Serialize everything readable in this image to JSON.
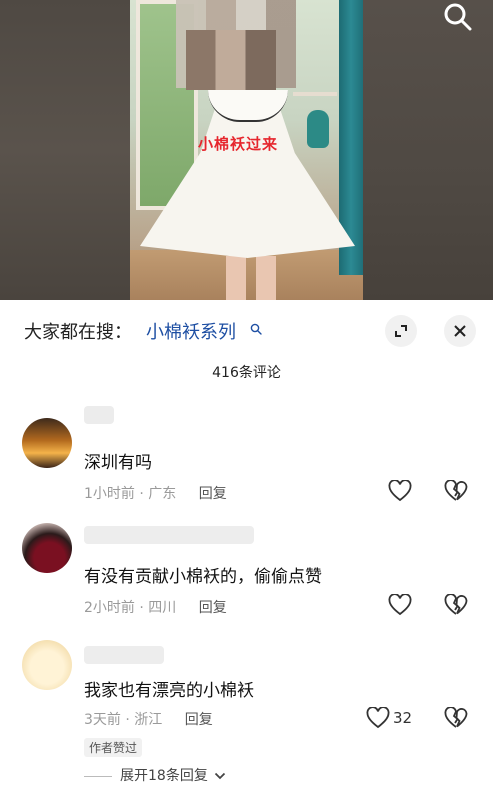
{
  "video": {
    "overlay_text": "小棉袄过来"
  },
  "sheet": {
    "search_prefix": "大家都在搜：",
    "search_term": "小棉袄系列",
    "comment_count": "416条评论"
  },
  "comments": [
    {
      "text": "深圳有吗",
      "time": "1小时前",
      "location": "广东",
      "reply_label": "回复"
    },
    {
      "text": "有没有贡献小棉袄的，偷偷点赞",
      "time": "2小时前",
      "location": "四川",
      "reply_label": "回复"
    },
    {
      "text": "我家也有漂亮的小棉袄",
      "time": "3天前",
      "location": "浙江",
      "reply_label": "回复",
      "like_count": "32",
      "badge": "作者赞过",
      "expand_label": "展开18条回复"
    }
  ],
  "icons": {
    "search": "search-icon",
    "expand": "expand-icon",
    "close": "close-icon",
    "like": "heart-icon",
    "dislike": "broken-heart-icon",
    "chevron": "chevron-down-icon"
  },
  "colors": {
    "search_term": "#1e4fa3",
    "overlay_text": "#e6262d",
    "meta": "#9a9a9a"
  }
}
